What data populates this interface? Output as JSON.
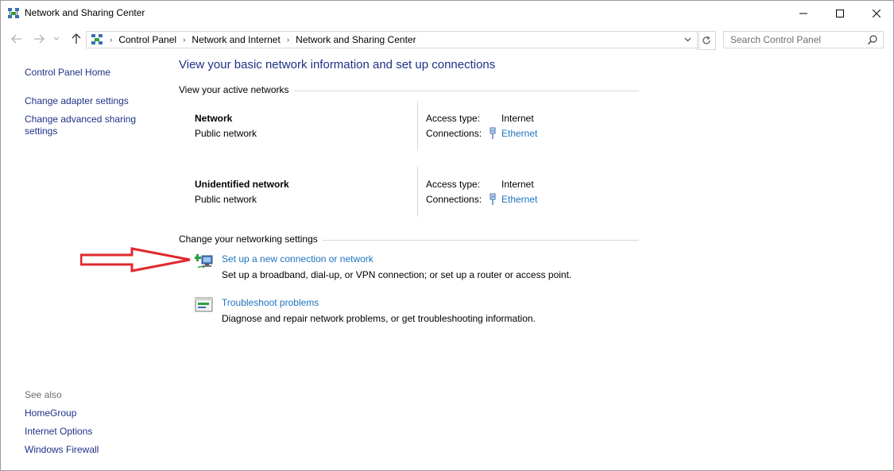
{
  "window": {
    "title": "Network and Sharing Center"
  },
  "address_bar": {
    "breadcrumbs": [
      "Control Panel",
      "Network and Internet",
      "Network and Sharing Center"
    ],
    "search_placeholder": "Search Control Panel"
  },
  "left_pane": {
    "links": [
      "Control Panel Home",
      "Change adapter settings",
      "Change advanced sharing settings"
    ],
    "see_also_title": "See also",
    "see_also": [
      "HomeGroup",
      "Internet Options",
      "Windows Firewall"
    ]
  },
  "main": {
    "heading": "View your basic network information and set up connections",
    "active_networks_title": "View your active networks",
    "networks": [
      {
        "name": "Network",
        "type": "Public network",
        "access_type_label": "Access type:",
        "access_type": "Internet",
        "connections_label": "Connections:",
        "connection": "Ethernet"
      },
      {
        "name": "Unidentified network",
        "type": "Public network",
        "access_type_label": "Access type:",
        "access_type": "Internet",
        "connections_label": "Connections:",
        "connection": "Ethernet"
      }
    ],
    "settings_title": "Change your networking settings",
    "tasks": [
      {
        "link": "Set up a new connection or network",
        "description": "Set up a broadband, dial-up, or VPN connection; or set up a router or access point.",
        "icon": "network-setup-icon"
      },
      {
        "link": "Troubleshoot problems",
        "description": "Diagnose and repair network problems, or get troubleshooting information.",
        "icon": "troubleshoot-icon"
      }
    ]
  },
  "annotation": {
    "icon": "red-arrow-icon",
    "color": "#e0282d"
  },
  "colors": {
    "link": "#1e73be",
    "heading": "#1e3287",
    "annotation": "#e0282d"
  }
}
